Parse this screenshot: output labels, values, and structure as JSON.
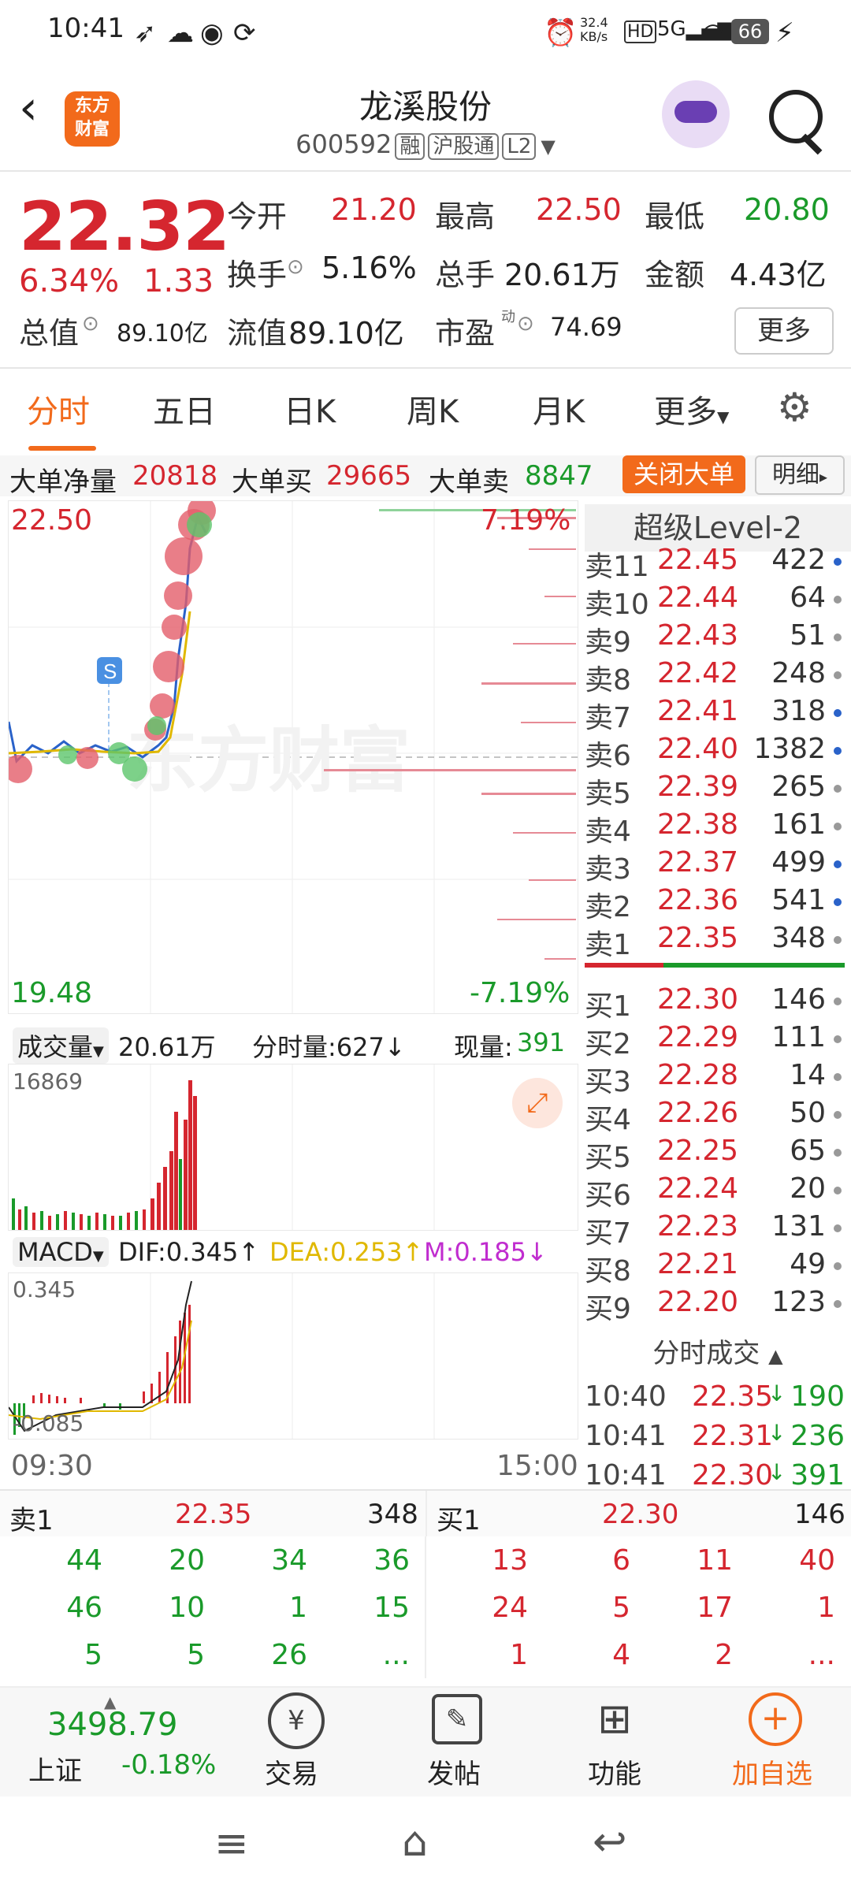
{
  "status": {
    "time": "10:41",
    "net_speed": "32.4\nKB/s",
    "battery": "66"
  },
  "header": {
    "title": "龙溪股份",
    "code": "600592",
    "tags": [
      "融",
      "沪股通",
      "L2"
    ],
    "logo_text": "东方\n财富"
  },
  "quote": {
    "price": "22.32",
    "change_pct": "6.34%",
    "change": "1.33",
    "open_label": "今开",
    "open": "21.20",
    "high_label": "最高",
    "high": "22.50",
    "low_label": "最低",
    "low": "20.80",
    "turnover_label": "换手",
    "turnover": "5.16%",
    "volume_label": "总手",
    "volume": "20.61万",
    "amount_label": "金额",
    "amount": "4.43亿",
    "mktcap_label": "总值",
    "mktcap": "89.10亿",
    "float_label": "流值",
    "float": "89.10亿",
    "pe_label": "市盈",
    "pe_sup": "动",
    "pe": "74.69",
    "more": "更多"
  },
  "tabs": [
    "分时",
    "五日",
    "日K",
    "周K",
    "月K",
    "更多"
  ],
  "bigorder": {
    "net_label": "大单净量",
    "net": "20818",
    "buy_label": "大单买",
    "buy": "29665",
    "sell_label": "大单卖",
    "sell": "8847",
    "close_btn": "关闭大单",
    "detail_btn": "明细"
  },
  "chart": {
    "top_price": "22.50",
    "bottom_price": "19.48",
    "top_pct": "7.19%",
    "bottom_pct": "-7.19%",
    "watermark": "东方财富",
    "marker": "S",
    "time_start": "09:30",
    "time_end": "15:00"
  },
  "volume": {
    "label": "成交量",
    "total": "20.61万",
    "period_label": "分时量:627↓",
    "now_label": "现量:",
    "now": "391",
    "max": "16869"
  },
  "macd": {
    "label": "MACD",
    "dif": "DIF:0.345↑",
    "dea": "DEA:0.253↑",
    "m": "M:0.185↓",
    "top": "0.345",
    "bottom": "-0.085"
  },
  "level2": {
    "title": "超级Level-2",
    "sells": [
      {
        "name": "卖11",
        "price": "22.45",
        "qty": "422",
        "dot": "blue"
      },
      {
        "name": "卖10",
        "price": "22.44",
        "qty": "64",
        "dot": "gray"
      },
      {
        "name": "卖9",
        "price": "22.43",
        "qty": "51",
        "dot": "gray"
      },
      {
        "name": "卖8",
        "price": "22.42",
        "qty": "248",
        "dot": "gray"
      },
      {
        "name": "卖7",
        "price": "22.41",
        "qty": "318",
        "dot": "blue"
      },
      {
        "name": "卖6",
        "price": "22.40",
        "qty": "1382",
        "dot": "blue"
      },
      {
        "name": "卖5",
        "price": "22.39",
        "qty": "265",
        "dot": "gray"
      },
      {
        "name": "卖4",
        "price": "22.38",
        "qty": "161",
        "dot": "gray"
      },
      {
        "name": "卖3",
        "price": "22.37",
        "qty": "499",
        "dot": "blue"
      },
      {
        "name": "卖2",
        "price": "22.36",
        "qty": "541",
        "dot": "blue"
      },
      {
        "name": "卖1",
        "price": "22.35",
        "qty": "348",
        "dot": "gray"
      }
    ],
    "buys": [
      {
        "name": "买1",
        "price": "22.30",
        "qty": "146",
        "dot": "gray"
      },
      {
        "name": "买2",
        "price": "22.29",
        "qty": "111",
        "dot": "gray"
      },
      {
        "name": "买3",
        "price": "22.28",
        "qty": "14",
        "dot": "gray"
      },
      {
        "name": "买4",
        "price": "22.26",
        "qty": "50",
        "dot": "gray"
      },
      {
        "name": "买5",
        "price": "22.25",
        "qty": "65",
        "dot": "gray"
      },
      {
        "name": "买6",
        "price": "22.24",
        "qty": "20",
        "dot": "gray"
      },
      {
        "name": "买7",
        "price": "22.23",
        "qty": "131",
        "dot": "gray"
      },
      {
        "name": "买8",
        "price": "22.21",
        "qty": "49",
        "dot": "gray"
      },
      {
        "name": "买9",
        "price": "22.20",
        "qty": "123",
        "dot": "gray"
      }
    ],
    "ticks_title": "分时成交",
    "ticks": [
      {
        "time": "10:40",
        "price": "22.35",
        "arrow": "↓",
        "qty": "190"
      },
      {
        "time": "10:41",
        "price": "22.31",
        "arrow": "↓",
        "qty": "236"
      },
      {
        "time": "10:41",
        "price": "22.30",
        "arrow": "↓",
        "qty": "391"
      }
    ]
  },
  "queue": {
    "sell_label": "卖1",
    "sell_price": "22.35",
    "sell_qty": "348",
    "buy_label": "买1",
    "buy_price": "22.30",
    "buy_qty": "146",
    "sell_rows": [
      [
        "44",
        "20",
        "34",
        "36"
      ],
      [
        "46",
        "10",
        "1",
        "15"
      ],
      [
        "5",
        "5",
        "26",
        "..."
      ]
    ],
    "buy_rows": [
      [
        "13",
        "6",
        "11",
        "40"
      ],
      [
        "24",
        "5",
        "17",
        "1"
      ],
      [
        "1",
        "4",
        "2",
        "..."
      ]
    ]
  },
  "footer": {
    "index_value": "3498.79",
    "index_name": "上证",
    "index_change": "-0.18%",
    "items": [
      "交易",
      "发帖",
      "功能",
      "加自选"
    ]
  }
}
